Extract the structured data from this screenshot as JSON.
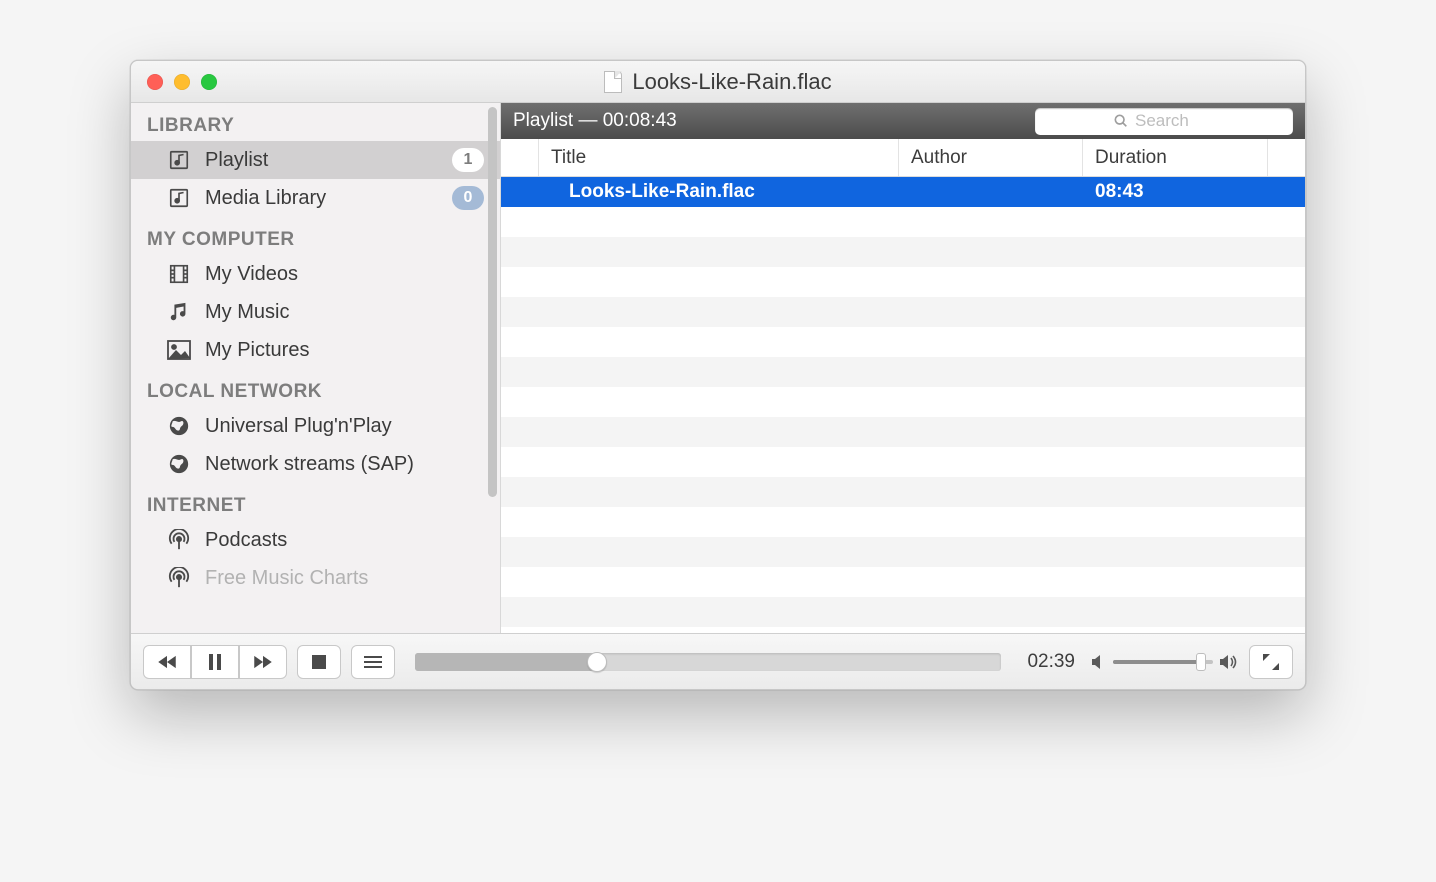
{
  "window": {
    "title": "Looks-Like-Rain.flac"
  },
  "sidebar": {
    "sections": [
      {
        "title": "LIBRARY",
        "items": [
          {
            "label": "Playlist",
            "icon": "playlist-icon",
            "badge": "1",
            "badge_style": "white",
            "selected": true
          },
          {
            "label": "Media Library",
            "icon": "media-library-icon",
            "badge": "0",
            "badge_style": "blue"
          }
        ]
      },
      {
        "title": "MY COMPUTER",
        "items": [
          {
            "label": "My Videos",
            "icon": "film-icon"
          },
          {
            "label": "My Music",
            "icon": "music-note-icon"
          },
          {
            "label": "My Pictures",
            "icon": "picture-icon"
          }
        ]
      },
      {
        "title": "LOCAL NETWORK",
        "items": [
          {
            "label": "Universal Plug'n'Play",
            "icon": "globe-icon"
          },
          {
            "label": "Network streams (SAP)",
            "icon": "globe-icon"
          }
        ]
      },
      {
        "title": "INTERNET",
        "items": [
          {
            "label": "Podcasts",
            "icon": "podcast-icon"
          },
          {
            "label": "Free Music Charts",
            "icon": "podcast-icon",
            "truncated": true
          }
        ]
      }
    ]
  },
  "playlist_header": {
    "label": "Playlist — 00:08:43"
  },
  "search": {
    "placeholder": "Search"
  },
  "columns": {
    "title": "Title",
    "author": "Author",
    "duration": "Duration"
  },
  "tracks": [
    {
      "title": "Looks-Like-Rain.flac",
      "author": "",
      "duration": "08:43",
      "selected": true
    }
  ],
  "playback": {
    "elapsed": "02:39",
    "progress_pct": 31,
    "volume_pct": 88
  }
}
